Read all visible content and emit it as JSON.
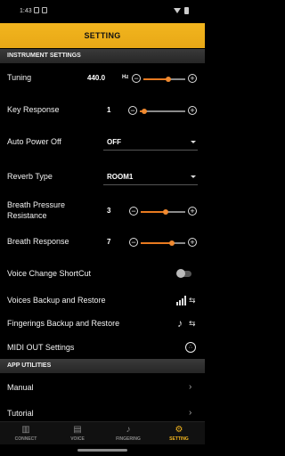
{
  "status": {
    "time": "1:43"
  },
  "header": {
    "title": "SETTING"
  },
  "sections": {
    "instrument": "INSTRUMENT SETTINGS",
    "app": "APP UTILITIES"
  },
  "settings": {
    "tuning": {
      "label": "Tuning",
      "value": "440.0",
      "unit": "Hz",
      "level": 0.6
    },
    "key_response": {
      "label": "Key Response",
      "value": "1",
      "level": 0.1
    },
    "auto_power_off": {
      "label": "Auto Power Off",
      "value": "OFF"
    },
    "reverb_type": {
      "label": "Reverb Type",
      "value": "ROOM1"
    },
    "breath_pressure": {
      "label_line1": "Breath Pressure",
      "label_line2": "Resistance",
      "value": "3",
      "level": 0.55
    },
    "breath_response": {
      "label": "Breath Response",
      "value": "7",
      "level": 0.7
    },
    "voice_change": {
      "label": "Voice Change ShortCut",
      "on": false
    },
    "voices_backup": {
      "label": "Voices Backup and Restore"
    },
    "fingerings_backup": {
      "label": "Fingerings Backup and Restore"
    },
    "midi_out": {
      "label": "MIDI OUT Settings"
    }
  },
  "app": {
    "manual": {
      "label": "Manual"
    },
    "tutorial": {
      "label": "Tutorial"
    }
  },
  "tabs": [
    {
      "label": "CONNECT",
      "icon": "connect-icon"
    },
    {
      "label": "VOICE",
      "icon": "voice-icon"
    },
    {
      "label": "FINGERING",
      "icon": "saxophone-icon"
    },
    {
      "label": "SETTING",
      "icon": "gear-icon",
      "active": true
    }
  ],
  "colors": {
    "accent": "#f2b51e",
    "slider": "#e87a20"
  }
}
